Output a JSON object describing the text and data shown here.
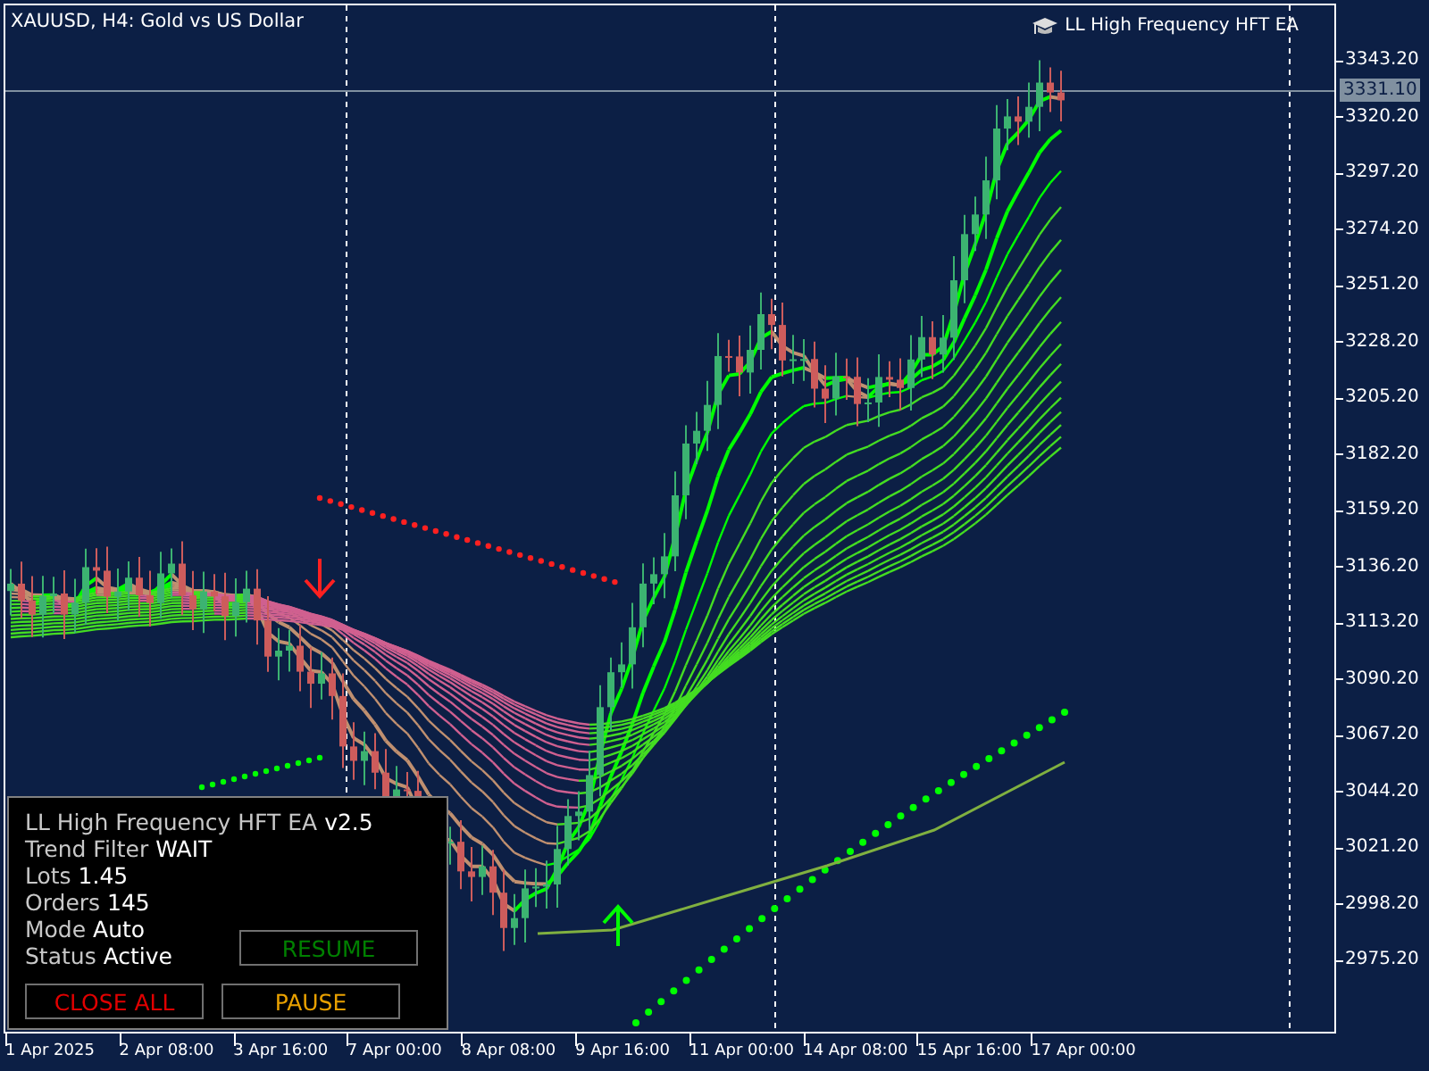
{
  "chart_header": {
    "symbol": "XAUUSD, H4:  Gold vs US Dollar",
    "expert_name": "LL High Frequency HFT EA"
  },
  "price_axis": {
    "ticks": [
      "3343.20",
      "3320.20",
      "3297.20",
      "3274.20",
      "3251.20",
      "3228.20",
      "3205.20",
      "3182.20",
      "3159.20",
      "3136.20",
      "3113.20",
      "3090.20",
      "3067.20",
      "3044.20",
      "3021.20",
      "2998.20",
      "2975.20"
    ],
    "current_price": "3331.10"
  },
  "time_axis": {
    "ticks": [
      "1 Apr 2025",
      "2 Apr 08:00",
      "3 Apr 16:00",
      "7 Apr 00:00",
      "8 Apr 08:00",
      "9 Apr 16:00",
      "11 Apr 00:00",
      "14 Apr 08:00",
      "15 Apr 16:00",
      "17 Apr 00:00"
    ]
  },
  "ea_panel": {
    "title": "LL High Frequency HFT EA",
    "version": "v2.5",
    "fields": [
      {
        "label": "Trend Filter",
        "value": "WAIT"
      },
      {
        "label": "Lots",
        "value": "1.45"
      },
      {
        "label": "Orders",
        "value": "145"
      },
      {
        "label": "Mode",
        "value": "Auto"
      },
      {
        "label": "Status",
        "value": "Active"
      }
    ],
    "buttons": [
      {
        "label": "RESUME",
        "color": "#008000"
      },
      {
        "label": "CLOSE ALL",
        "color": "#e00000"
      },
      {
        "label": "PAUSE",
        "color": "#e8a000"
      }
    ]
  }
}
